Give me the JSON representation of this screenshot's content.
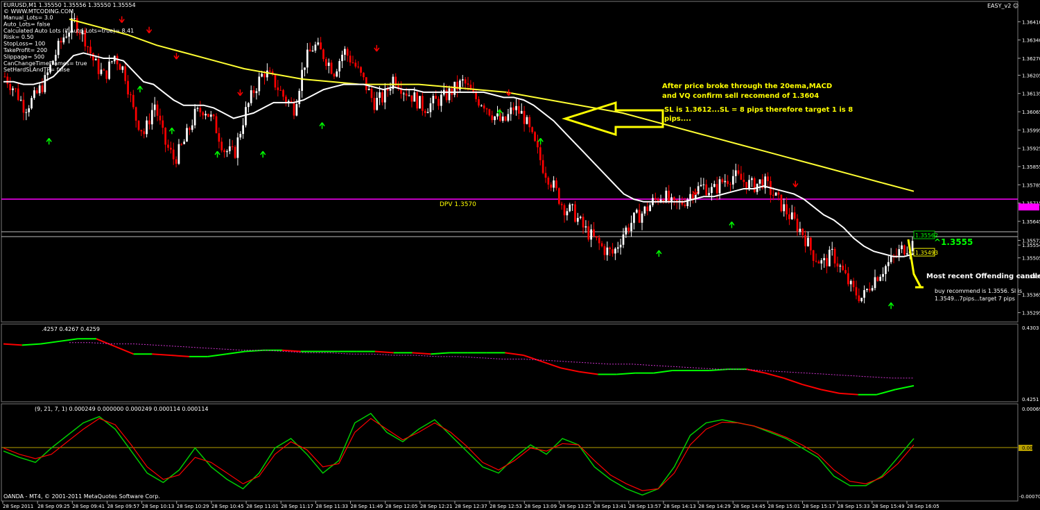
{
  "header": {
    "symbol_line": "EURUSD,M1  1.35550 1.35556 1.35550 1.35554",
    "site": "© WWW.MTCODING.COM",
    "indicator_name": "EASY_v2 ☺"
  },
  "settings_lines": [
    "Manual_Lots= 3.0",
    "Auto_Lots= false",
    "Calculated Auto Lots (if Auto_Lots=true)= 8.41",
    "Risk= 0.50",
    "StopLoss= 100",
    "TakeProfit= 200",
    "Slippage= 500",
    "CanChangeTimeFrames= true",
    "SetHardSLAndTP= false"
  ],
  "annotations": {
    "sell_note_1": "After price broke through the 20ema,MACD",
    "sell_note_2": "and VQ confirm sell recomend of 1.3604",
    "sl_note_1": "SL is 1.3612...SL = 8 pips therefore target 1 is 8",
    "sl_note_2": "pips....",
    "dpv": "DPV   1.3570",
    "big_price": "^1.3555",
    "offending": "Most recent Offending candle",
    "buy_note_1": "buy recommend is 1.3556.  Sl is",
    "buy_note_2": "1.3549...7pips...target 7 pips",
    "price_tag_high": "1.35562",
    "price_tag_low": "1.35493"
  },
  "footer": {
    "copyright": "OANDA - MT4, © 2001-2011 MetaQuotes Software Corp."
  },
  "colors": {
    "background": "#000000",
    "bull_candle": "#ffffff",
    "bear_candle": "#ff0000",
    "ema_fast": "#ffffff",
    "ema_slow": "#ffff33",
    "dpv_line": "#ff00ff",
    "up_arrow": "#00ff00",
    "down_arrow": "#ff0000",
    "annotation_text": "#ffff00",
    "vq_up": "#00ff00",
    "vq_down": "#ff0000",
    "macd_main": "#00cc00",
    "macd_signal": "#ff0000",
    "zero_line": "#b8a000"
  },
  "chart_data": [
    {
      "type": "candlestick",
      "title": "EURUSD,M1",
      "y_ticks": [
        "1.36410",
        "1.36340",
        "1.36270",
        "1.36205",
        "1.36135",
        "1.36065",
        "1.35995",
        "1.35925",
        "1.35855",
        "1.35785",
        "1.35715",
        "1.35645",
        "1.35572",
        "1.35554",
        "1.35505",
        "1.35435",
        "1.35365",
        "1.35295"
      ],
      "ylim": [
        1.3527,
        1.3648
      ],
      "x_ticks": [
        "28 Sep 2011",
        "28 Sep 09:25",
        "28 Sep 09:41",
        "28 Sep 09:57",
        "28 Sep 10:13",
        "28 Sep 10:29",
        "28 Sep 10:45",
        "28 Sep 11:01",
        "28 Sep 11:17",
        "28 Sep 11:33",
        "28 Sep 11:49",
        "28 Sep 12:05",
        "28 Sep 12:21",
        "28 Sep 12:37",
        "28 Sep 12:53",
        "28 Sep 13:09",
        "28 Sep 13:25",
        "28 Sep 13:41",
        "28 Sep 13:57",
        "28 Sep 14:13",
        "28 Sep 14:29",
        "28 Sep 14:45",
        "28 Sep 15:01",
        "28 Sep 15:17",
        "28 Sep 15:33",
        "28 Sep 15:49",
        "28 Sep 16:05"
      ],
      "close_path": [
        1.362,
        1.3615,
        1.3608,
        1.3612,
        1.3618,
        1.3628,
        1.3636,
        1.3641,
        1.3635,
        1.3625,
        1.362,
        1.3628,
        1.3622,
        1.3605,
        1.3598,
        1.361,
        1.3595,
        1.3588,
        1.3595,
        1.3605,
        1.3608,
        1.3602,
        1.3592,
        1.359,
        1.3605,
        1.3615,
        1.3622,
        1.3618,
        1.3612,
        1.3608,
        1.3625,
        1.3632,
        1.3628,
        1.3622,
        1.363,
        1.3625,
        1.3618,
        1.361,
        1.3612,
        1.362,
        1.3615,
        1.3612,
        1.3608,
        1.361,
        1.3612,
        1.3615,
        1.3618,
        1.3612,
        1.361,
        1.3605,
        1.3602,
        1.3608,
        1.3605,
        1.3595,
        1.3585,
        1.3578,
        1.357,
        1.3568,
        1.3562,
        1.3558,
        1.3554,
        1.3552,
        1.356,
        1.3565,
        1.3568,
        1.3572,
        1.3575,
        1.357,
        1.3572,
        1.3576,
        1.3578,
        1.3576,
        1.358,
        1.3582,
        1.358,
        1.3578,
        1.358,
        1.3575,
        1.357,
        1.3565,
        1.356,
        1.3552,
        1.3548,
        1.3552,
        1.3545,
        1.3538,
        1.3535,
        1.3542,
        1.3546,
        1.355,
        1.3554,
        1.3556
      ],
      "ema20": [
        1.3618,
        1.3618,
        1.3617,
        1.3617,
        1.3618,
        1.362,
        1.3624,
        1.3628,
        1.3629,
        1.3628,
        1.3627,
        1.3627,
        1.3626,
        1.3622,
        1.3618,
        1.3617,
        1.3614,
        1.3611,
        1.3609,
        1.3609,
        1.3609,
        1.3608,
        1.3606,
        1.3604,
        1.3605,
        1.3606,
        1.3608,
        1.361,
        1.361,
        1.361,
        1.3611,
        1.3613,
        1.3615,
        1.3616,
        1.3617,
        1.3617,
        1.3617,
        1.3616,
        1.3615,
        1.3616,
        1.3615,
        1.3615,
        1.3614,
        1.3614,
        1.3614,
        1.3614,
        1.3614,
        1.3614,
        1.3614,
        1.3613,
        1.3612,
        1.3612,
        1.3611,
        1.3609,
        1.3606,
        1.3603,
        1.3599,
        1.3595,
        1.3591,
        1.3587,
        1.3583,
        1.3579,
        1.3575,
        1.3573,
        1.3572,
        1.3572,
        1.3572,
        1.3572,
        1.3572,
        1.3573,
        1.3574,
        1.3574,
        1.3575,
        1.3576,
        1.3577,
        1.3577,
        1.3578,
        1.3577,
        1.3576,
        1.3575,
        1.3573,
        1.357,
        1.3567,
        1.3565,
        1.3562,
        1.3558,
        1.3555,
        1.3553,
        1.3552,
        1.3551,
        1.3551,
        1.3552
      ],
      "ema_slow": [
        1.3642,
        1.3639,
        1.3636,
        1.3632,
        1.3629,
        1.3626,
        1.3623,
        1.3621,
        1.3619,
        1.3618,
        1.3617,
        1.3617,
        1.3617,
        1.3616,
        1.3615,
        1.3614,
        1.3612,
        1.361,
        1.3608,
        1.3606,
        1.3603,
        1.36,
        1.3597,
        1.3594,
        1.3591,
        1.3588,
        1.3585,
        1.3582,
        1.3579,
        1.3576
      ],
      "dpv_level": 1.357,
      "recent_high_level": 1.3557,
      "recent_low_level": 1.3555
    },
    {
      "type": "line",
      "title": "VQ",
      "header_values": ".4257 0.4267 0.4259",
      "y_ticks": [
        "0.4303",
        "0.4251"
      ],
      "ylim": [
        0.4248,
        0.4306
      ],
      "series": [
        {
          "values": [
            0.4292,
            0.4291,
            0.4292,
            0.4294,
            0.4296,
            0.4296,
            0.429,
            0.4284,
            0.4284,
            0.4283,
            0.4282,
            0.4282,
            0.4284,
            0.4286,
            0.4287,
            0.4287,
            0.4286,
            0.4286,
            0.4286,
            0.4286,
            0.4286,
            0.4285,
            0.4285,
            0.4284,
            0.4285,
            0.4285,
            0.4285,
            0.4285,
            0.4283,
            0.4278,
            0.4273,
            0.427,
            0.4268,
            0.4268,
            0.4269,
            0.4269,
            0.4271,
            0.4271,
            0.4271,
            0.4272,
            0.4272,
            0.4269,
            0.4265,
            0.426,
            0.4256,
            0.4253,
            0.4252,
            0.4252,
            0.4256,
            0.4259
          ]
        }
      ],
      "signal_series": [
        0.4293,
        0.4293,
        0.4292,
        0.4292,
        0.4291,
        0.429,
        0.4289,
        0.4288,
        0.4287,
        0.4287,
        0.4286,
        0.4285,
        0.4285,
        0.4284,
        0.4284,
        0.4283,
        0.4283,
        0.4282,
        0.4282,
        0.4281,
        0.428,
        0.428,
        0.4279,
        0.4278,
        0.4277,
        0.4276,
        0.4276,
        0.4275,
        0.4274,
        0.4273,
        0.4272,
        0.4272,
        0.4271,
        0.427,
        0.4269,
        0.4268,
        0.4267,
        0.4266,
        0.4265,
        0.4265
      ]
    },
    {
      "type": "line",
      "title": "MACD",
      "header_values": "(9, 21, 7, 1) 0.000249 0.000000 0.000249 0.000114 0.000114",
      "y_ticks": [
        "0.00069",
        "0.00",
        "-0.00070"
      ],
      "ylim": [
        -0.00075,
        0.00072
      ],
      "series": [
        {
          "values": [
            0.0,
            -0.0001,
            -0.00018,
            5e-05,
            0.00025,
            0.00045,
            0.00055,
            0.00035,
            0.0,
            -0.00035,
            -0.0005,
            -0.0003,
            5e-05,
            -0.00025,
            -0.00045,
            -0.0006,
            -0.00035,
            5e-05,
            0.0002,
            -5e-05,
            -0.00035,
            -0.00015,
            0.00045,
            0.0006,
            0.0003,
            0.00015,
            0.00035,
            0.0005,
            0.00025,
            0.0,
            -0.00025,
            -0.00035,
            -0.0001,
            0.0001,
            -5e-05,
            0.0002,
            0.0001,
            -0.00025,
            -0.00045,
            -0.0006,
            -0.0007,
            -0.0006,
            -0.00025,
            0.00025,
            0.00045,
            0.0005,
            0.00045,
            0.0004,
            0.0003,
            0.0002,
            5e-05,
            -0.0001,
            -0.0004,
            -0.00055,
            -0.00055,
            -0.0004,
            -0.0001,
            0.0002
          ]
        },
        {
          "values": [
            5e-05,
            -5e-05,
            -0.00012,
            -5e-05,
            0.00015,
            0.00035,
            0.00052,
            0.00042,
            0.0001,
            -0.00025,
            -0.00045,
            -0.00038,
            -0.0001,
            -0.00018,
            -0.00035,
            -0.00052,
            -0.0004,
            -5e-05,
            0.00015,
            2e-05,
            -0.00025,
            -0.0002,
            0.0003,
            0.00052,
            0.00035,
            0.00018,
            0.0003,
            0.00045,
            0.0003,
            8e-05,
            -0.00018,
            -0.0003,
            -0.00015,
            5e-05,
            0.0,
            0.00012,
            0.0001,
            -0.00015,
            -0.00038,
            -0.00052,
            -0.00063,
            -0.0006,
            -0.00035,
            0.0001,
            0.00035,
            0.00046,
            0.00045,
            0.0004,
            0.00032,
            0.00022,
            0.0001,
            -5e-05,
            -0.0003,
            -0.00048,
            -0.00052,
            -0.00042,
            -0.0002,
            0.0001
          ]
        }
      ]
    }
  ]
}
